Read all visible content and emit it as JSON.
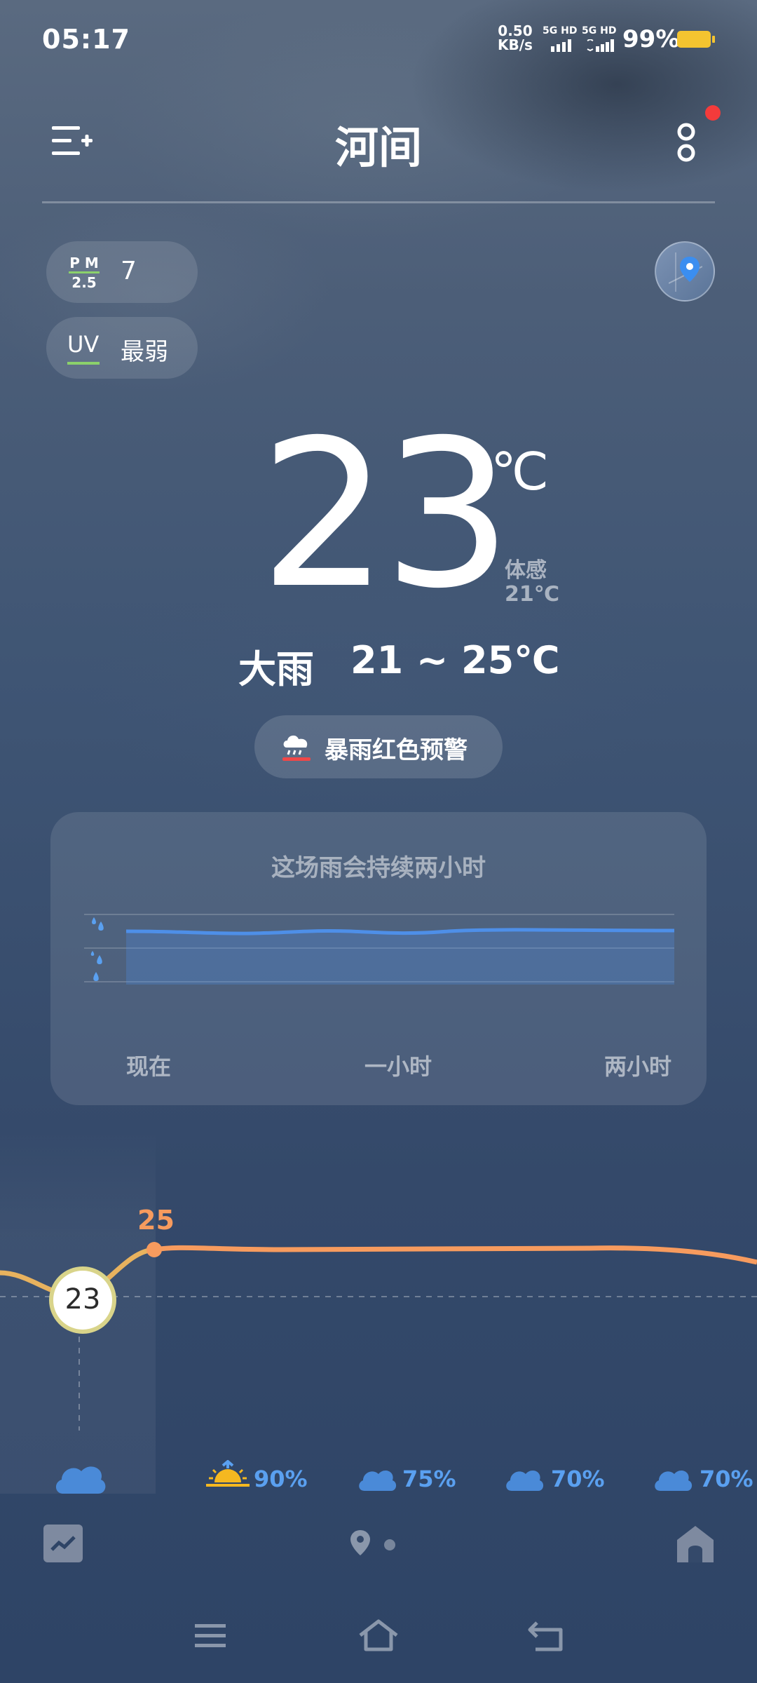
{
  "status_bar": {
    "time": "05:17",
    "net_speed_value": "0.50",
    "net_speed_unit": "KB/s",
    "signal_1": "5G HD",
    "signal_2": "5G HD",
    "battery": "99%",
    "battery_color": "#f4c430"
  },
  "header": {
    "city": "河间",
    "menu_icon": "add-city-list-icon",
    "more_icon": "more-vertical-icon",
    "notification_dot_color": "#f43b3b"
  },
  "air": {
    "pm_label_top": "P M",
    "pm_label_bottom": "2.5",
    "pm_value": "7",
    "uv_label": "UV",
    "uv_value": "最弱",
    "indicator_color": "#8bd16b"
  },
  "current": {
    "temperature": "23",
    "unit": "℃",
    "feels_label": "体感",
    "feels_value": "21℃",
    "condition": "大雨",
    "range": "21 ~ 25℃"
  },
  "alert": {
    "text": "暴雨红色预警",
    "icon": "heavy-rain-warning-icon"
  },
  "rain_forecast": {
    "title": "这场雨会持续两小时",
    "labels": [
      "现在",
      "一小时",
      "两小时"
    ],
    "line_color": "#4e8fe8"
  },
  "hourly": {
    "now_temp": "23",
    "high_label": "25",
    "line_color": "#f79b5e",
    "items": [
      {
        "icon": "cloud-icon",
        "pop": ""
      },
      {
        "icon": "sunrise-icon",
        "pop": "90%"
      },
      {
        "icon": "cloud-icon",
        "pop": "75%"
      },
      {
        "icon": "cloud-icon",
        "pop": "70%"
      },
      {
        "icon": "cloud-icon",
        "pop": "70%"
      }
    ]
  },
  "bottom": {
    "trend_icon": "trend-chart-icon",
    "location_icon": "location-pin-icon",
    "home_icon": "home-icon"
  },
  "nav": {
    "menu_icon": "nav-menu-icon",
    "home_icon": "nav-home-icon",
    "back_icon": "nav-back-icon"
  }
}
